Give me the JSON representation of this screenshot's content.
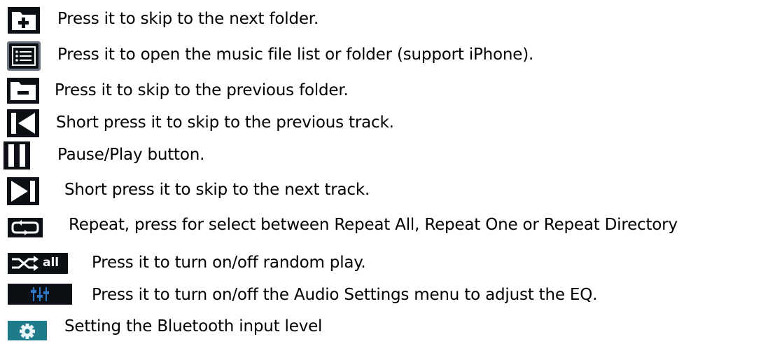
{
  "colors": {
    "icon_dark": "#0c0f14",
    "icon_border": "#6b7380",
    "icon_blue": "#2d78c8",
    "icon_teal": "#1f7a8c"
  },
  "items": [
    {
      "icon": "next-folder-icon",
      "text": "Press it to skip to the next folder."
    },
    {
      "icon": "file-list-icon",
      "text": "Press it to open the music file list or folder (support iPhone)."
    },
    {
      "icon": "previous-folder-icon",
      "text": "Press it to skip to the previous folder."
    },
    {
      "icon": "previous-track-icon",
      "text": "Short press it to skip to the previous track."
    },
    {
      "icon": "pause-play-icon",
      "text": "Pause/Play button."
    },
    {
      "icon": "next-track-icon",
      "text": "Short press it to skip to the next track."
    },
    {
      "icon": "repeat-icon",
      "text": "Repeat, press for select between Repeat All, Repeat One or Repeat Directory"
    },
    {
      "icon": "shuffle-all-icon",
      "text": "Press it to turn on/off random play.",
      "icon_label": "all"
    },
    {
      "icon": "eq-sliders-icon",
      "text": "Press it to turn on/off the Audio Settings menu to adjust the EQ."
    },
    {
      "icon": "settings-gear-icon",
      "text": "Setting the Bluetooth input level"
    }
  ]
}
